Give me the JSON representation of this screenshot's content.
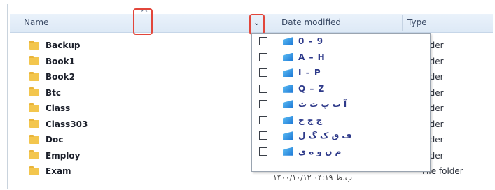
{
  "header": {
    "name_label": "Name",
    "date_label": "Date modified",
    "type_label": "Type",
    "sort_arrow": "^",
    "chevron": "⌄"
  },
  "files": [
    {
      "name": "Backup"
    },
    {
      "name": "Book1"
    },
    {
      "name": "Book2"
    },
    {
      "name": "Btc"
    },
    {
      "name": "Class"
    },
    {
      "name": "Class303"
    },
    {
      "name": "Doc"
    },
    {
      "name": "Employ"
    },
    {
      "name": "Exam"
    }
  ],
  "type_values": [
    "older",
    "older",
    "older",
    "older",
    "older",
    "older",
    "older",
    "older",
    "File folder"
  ],
  "last_row_date": "۱۴۰۰/۱۰/۱۲ ب.ظ ۰۴:۱۹",
  "filter_menu": {
    "items": [
      {
        "label": "0 – 9",
        "checked": false
      },
      {
        "label": "A – H",
        "checked": false
      },
      {
        "label": "I – P",
        "checked": false
      },
      {
        "label": "Q – Z",
        "checked": false
      },
      {
        "label": "آ ب پ ت ث",
        "checked": false
      },
      {
        "label": "ج چ ح",
        "checked": false
      },
      {
        "label": "ف ق ک گ ل",
        "checked": false
      },
      {
        "label": "م ن و ه ی",
        "checked": false
      }
    ]
  },
  "colors": {
    "header_bg": "#dde9f6",
    "highlight_box": "#e2463b",
    "folder": "#f3c64e",
    "group_icon": "#1e79d6"
  }
}
